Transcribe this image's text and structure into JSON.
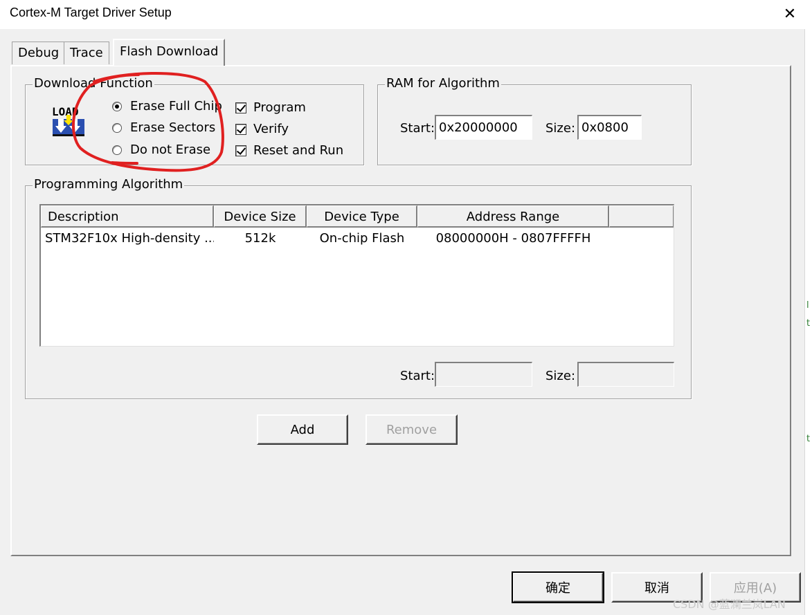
{
  "window": {
    "title": "Cortex-M Target Driver Setup"
  },
  "tabs": [
    {
      "label": "Debug",
      "active": false
    },
    {
      "label": "Trace",
      "active": false
    },
    {
      "label": "Flash Download",
      "active": true
    }
  ],
  "download_function": {
    "legend": "Download Function",
    "icon_text": "LOAD",
    "erase_options": [
      {
        "label": "Erase Full Chip",
        "selected": true
      },
      {
        "label": "Erase Sectors",
        "selected": false
      },
      {
        "label": "Do not Erase",
        "selected": false
      }
    ],
    "checkboxes": [
      {
        "label": "Program",
        "checked": true
      },
      {
        "label": "Verify",
        "checked": true
      },
      {
        "label": "Reset and Run",
        "checked": true
      }
    ]
  },
  "ram_for_algorithm": {
    "legend": "RAM for Algorithm",
    "start_label": "Start:",
    "start_value": "0x20000000",
    "size_label": "Size:",
    "size_value": "0x0800"
  },
  "programming_algorithm": {
    "legend": "Programming Algorithm",
    "columns": [
      "Description",
      "Device Size",
      "Device Type",
      "Address Range"
    ],
    "rows": [
      {
        "description": "STM32F10x High-density ...",
        "device_size": "512k",
        "device_type": "On-chip Flash",
        "address_range": "08000000H - 0807FFFFH"
      }
    ],
    "start_label": "Start:",
    "start_value": "",
    "size_label": "Size:",
    "size_value": ""
  },
  "buttons": {
    "add": "Add",
    "remove": "Remove",
    "ok": "确定",
    "cancel": "取消",
    "apply": "应用(A)"
  },
  "watermark": "CSDN @蓝澜兰岚LAN",
  "colors": {
    "annotation_circle": "#e02020",
    "dialog_bg": "#f0f0f0"
  }
}
